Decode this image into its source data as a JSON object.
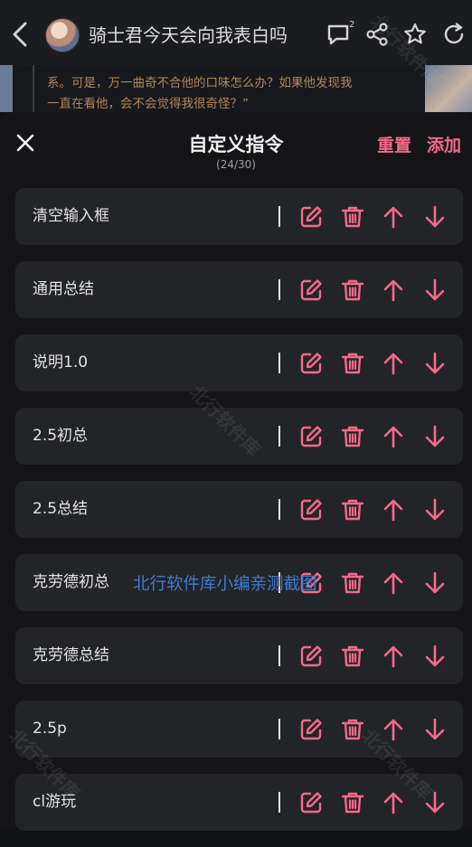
{
  "header": {
    "title": "骑士君今天会向我表白吗",
    "comment_badge": "2"
  },
  "background_message": {
    "line_a": "",
    "line_b": "系。可是，万一曲奇不合他的口味怎么办？如果他发现我",
    "line_c": "一直在看他，会不会觉得我很奇怪？”"
  },
  "sheet": {
    "title": "自定义指令",
    "counter": "(24/30)",
    "reset_label": "重置",
    "add_label": "添加"
  },
  "commands": [
    {
      "label": "清空输入框"
    },
    {
      "label": "通用总结"
    },
    {
      "label": "说明1.0"
    },
    {
      "label": "2.5初总"
    },
    {
      "label": "2.5总结"
    },
    {
      "label": "克劳德初总"
    },
    {
      "label": "克劳德总结"
    },
    {
      "label": "2.5p"
    },
    {
      "label": "cl游玩"
    }
  ],
  "watermarks": {
    "text": "北行软件库",
    "overlay": "北行软件库小编亲测截图"
  },
  "colors": {
    "accent": "#f46a8c",
    "card": "#232427",
    "sheet": "#151518"
  },
  "icons": [
    "back-icon",
    "comment-icon",
    "share-icon",
    "star-icon",
    "refresh-icon",
    "close-icon",
    "edit-icon",
    "trash-icon",
    "arrow-up-icon",
    "arrow-down-icon"
  ]
}
